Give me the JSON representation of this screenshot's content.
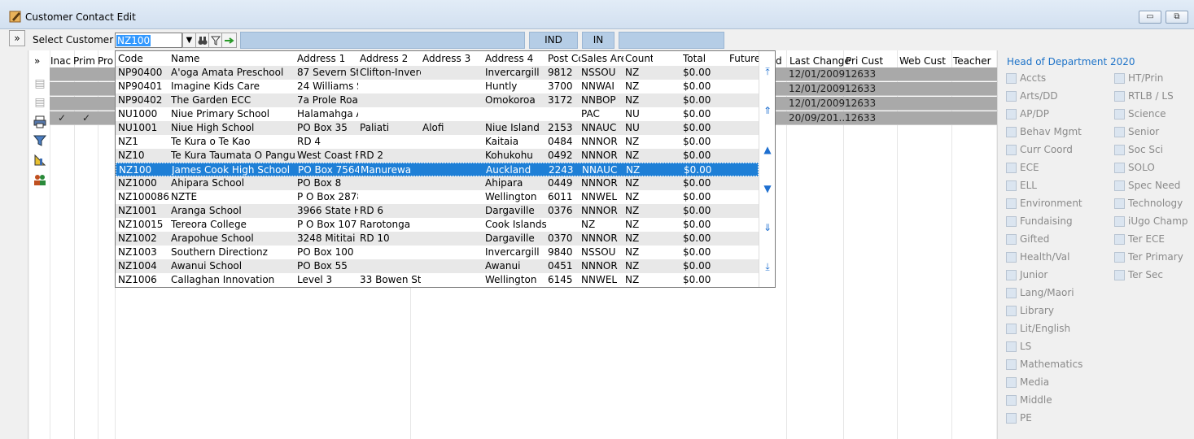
{
  "window": {
    "title": "Customer Contact Edit",
    "minimize_label": "▭",
    "restore_label": "⧉"
  },
  "toolbar": {
    "expand_label": "»",
    "select_customer_label": "Select Customer",
    "customer_value": "NZ100",
    "dropdown_arrow": "▼",
    "ind_label": "IND",
    "in_label": "IN"
  },
  "grid": {
    "expand_label": "»",
    "headers": {
      "inac": "Inac",
      "prim": "Prim",
      "pro": "Pro",
      "d": "d",
      "last_change": "Last Change",
      "pri_cust": "Pri Cust",
      "web_cust": "Web Cust",
      "teacher": "Teacher A"
    },
    "rows": [
      {
        "inac": "",
        "prim": "",
        "last_change": "12/01/2009 ...",
        "pri_cust": "12633"
      },
      {
        "inac": "",
        "prim": "",
        "last_change": "12/01/2009 ...",
        "pri_cust": "12633"
      },
      {
        "inac": "",
        "prim": "",
        "last_change": "12/01/2009 ...",
        "pri_cust": "12633"
      },
      {
        "inac": "✓",
        "prim": "✓",
        "last_change": "20/09/201...",
        "pri_cust": "12633"
      }
    ]
  },
  "dropdown": {
    "headers": {
      "code": "Code",
      "name": "Name",
      "addr1": "Address 1",
      "addr2": "Address 2",
      "addr3": "Address 3",
      "addr4": "Address 4",
      "post": "Post Co",
      "sales": "Sales Area",
      "country": "Count",
      "total": "Total",
      "future": "Future"
    },
    "rows": [
      {
        "code": "NP90400",
        "name": "A'oga Amata Preschool",
        "addr1": "87 Severn Stre",
        "addr2": "Clifton-Inverc",
        "addr3": "",
        "addr4": "Invercargill",
        "post": "9812",
        "sales": "NSSOU",
        "country": "NZ",
        "total": "$0.00"
      },
      {
        "code": "NP90401",
        "name": "Imagine Kids Care",
        "addr1": "24 Williams St",
        "addr2": "",
        "addr3": "",
        "addr4": "Huntly",
        "post": "3700",
        "sales": "NNWAI",
        "country": "NZ",
        "total": "$0.00"
      },
      {
        "code": "NP90402",
        "name": "The Garden ECC",
        "addr1": "7a Prole Road",
        "addr2": "",
        "addr3": "",
        "addr4": "Omokoroa",
        "post": "3172",
        "sales": "NNBOP",
        "country": "NZ",
        "total": "$0.00"
      },
      {
        "code": "NU1000",
        "name": "Niue Primary School",
        "addr1": "Halamahga Al",
        "addr2": "",
        "addr3": "",
        "addr4": "",
        "post": "",
        "sales": "PAC",
        "country": "NU",
        "total": "$0.00"
      },
      {
        "code": "NU1001",
        "name": "Niue High School",
        "addr1": "PO Box 35",
        "addr2": "Paliati",
        "addr3": "Alofi",
        "addr4": "Niue Island",
        "post": "2153",
        "sales": "NNAUC",
        "country": "NU",
        "total": "$0.00"
      },
      {
        "code": "NZ1",
        "name": "Te Kura o Te Kao",
        "addr1": "RD 4",
        "addr2": "",
        "addr3": "",
        "addr4": "Kaitaia",
        "post": "0484",
        "sales": "NNNOR",
        "country": "NZ",
        "total": "$0.00"
      },
      {
        "code": "NZ10",
        "name": "Te Kura Taumata O Panguru",
        "addr1": "West Coast Rc",
        "addr2": "RD 2",
        "addr3": "",
        "addr4": "Kohukohu",
        "post": "0492",
        "sales": "NNNOR",
        "country": "NZ",
        "total": "$0.00"
      },
      {
        "code": "NZ100",
        "name": "James Cook High School",
        "addr1": "PO Box 75647",
        "addr2": "Manurewa",
        "addr3": "",
        "addr4": "Auckland",
        "post": "2243",
        "sales": "NNAUC",
        "country": "NZ",
        "total": "$0.00"
      },
      {
        "code": "NZ1000",
        "name": "Ahipara School",
        "addr1": "PO Box 8",
        "addr2": "",
        "addr3": "",
        "addr4": "Ahipara",
        "post": "0449",
        "sales": "NNNOR",
        "country": "NZ",
        "total": "$0.00"
      },
      {
        "code": "NZ100086",
        "name": "NZTE",
        "addr1": "P O Box 2878",
        "addr2": "",
        "addr3": "",
        "addr4": "Wellington",
        "post": "6011",
        "sales": "NNWEL",
        "country": "NZ",
        "total": "$0.00"
      },
      {
        "code": "NZ1001",
        "name": "Aranga School",
        "addr1": "3966 State Hig",
        "addr2": "RD 6",
        "addr3": "",
        "addr4": "Dargaville",
        "post": "0376",
        "sales": "NNNOR",
        "country": "NZ",
        "total": "$0.00"
      },
      {
        "code": "NZ10015",
        "name": "Tereora College",
        "addr1": "P O Box 107",
        "addr2": "Rarotonga",
        "addr3": "",
        "addr4": "Cook Islands",
        "post": "",
        "sales": "NZ",
        "country": "NZ",
        "total": "$0.00"
      },
      {
        "code": "NZ1002",
        "name": "Arapohue School",
        "addr1": "3248 Mititai Rc",
        "addr2": "RD 10",
        "addr3": "",
        "addr4": "Dargaville",
        "post": "0370",
        "sales": "NNNOR",
        "country": "NZ",
        "total": "$0.00"
      },
      {
        "code": "NZ1003",
        "name": "Southern Directionz",
        "addr1": "PO Box 100",
        "addr2": "",
        "addr3": "",
        "addr4": "Invercargill",
        "post": "9840",
        "sales": "NSSOU",
        "country": "NZ",
        "total": "$0.00"
      },
      {
        "code": "NZ1004",
        "name": "Awanui School",
        "addr1": "PO Box 55",
        "addr2": "",
        "addr3": "",
        "addr4": "Awanui",
        "post": "0451",
        "sales": "NNNOR",
        "country": "NZ",
        "total": "$0.00"
      },
      {
        "code": "NZ1006",
        "name": "Callaghan Innovation",
        "addr1": "Level 3",
        "addr2": "33 Bowen Stre",
        "addr3": "",
        "addr4": "Wellington",
        "post": "6145",
        "sales": "NNWEL",
        "country": "NZ",
        "total": "$0.00"
      }
    ],
    "scroll": {
      "top": "⤒",
      "page_up": "⇑",
      "up": "▲",
      "down": "▼",
      "page_down": "⇓",
      "bottom": "⤓"
    }
  },
  "right_panel": {
    "title": "Head of Department 2020",
    "col1": [
      "Accts",
      "Arts/DD",
      "AP/DP",
      "Behav Mgmt",
      "Curr Coord",
      "ECE",
      "ELL",
      "Environment",
      "Fundaising",
      "Gifted",
      "Health/Val",
      "Junior",
      "Lang/Maori",
      "Library",
      "Lit/English",
      "LS",
      "Mathematics",
      "Media",
      "Middle",
      "PE"
    ],
    "col2": [
      "HT/Prin",
      "RTLB / LS",
      "Science",
      "Senior",
      "Soc Sci",
      "SOLO",
      "Spec Need",
      "Technology",
      "iUgo Champ",
      "Ter ECE",
      "Ter Primary",
      "Ter Sec"
    ]
  },
  "colors": {
    "selection": "#1e7fd6",
    "accent": "#1e73c8",
    "grid_row": "#a9a9a9"
  }
}
